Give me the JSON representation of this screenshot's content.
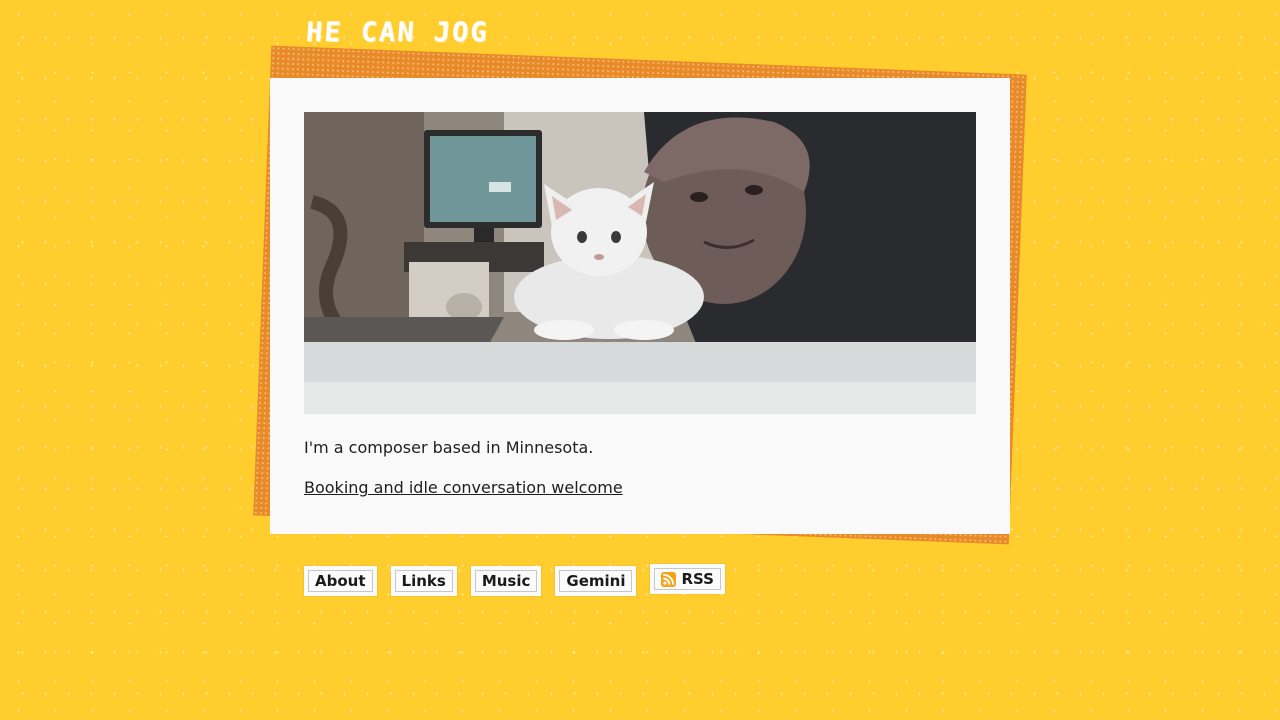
{
  "site": {
    "logo_text": "HE CAN JOG"
  },
  "main": {
    "photo_alt": "",
    "intro_text": "I'm a composer based in Minnesota.",
    "booking_link_text": "Booking and idle conversation welcome"
  },
  "nav": {
    "items": [
      {
        "label": "About"
      },
      {
        "label": "Links"
      },
      {
        "label": "Music"
      },
      {
        "label": "Gemini"
      },
      {
        "label": "RSS",
        "icon": "rss-icon"
      }
    ]
  },
  "colors": {
    "background": "#ffcd2e",
    "card": "#f9f9f9",
    "card_shadow": "#e8892a",
    "rss_icon": "#f7a21b"
  }
}
